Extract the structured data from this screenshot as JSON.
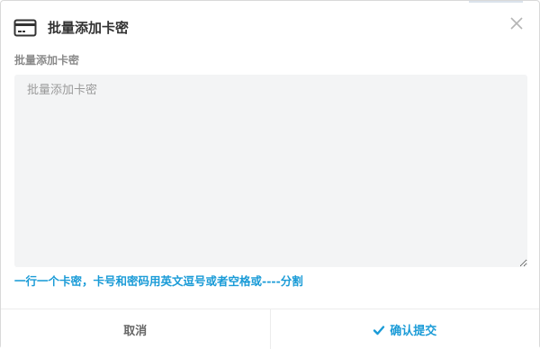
{
  "dialog": {
    "title": "批量添加卡密",
    "icon": "credit-card-icon",
    "close_icon": "close-icon"
  },
  "form": {
    "label": "批量添加卡密",
    "placeholder": "批量添加卡密",
    "value": "",
    "hint": "一行一个卡密，卡号和密码用英文逗号或者空格或----分割"
  },
  "footer": {
    "cancel_label": "取消",
    "confirm_label": "确认提交",
    "confirm_icon": "check-icon"
  },
  "colors": {
    "accent": "#1a9bd7",
    "textarea_bg": "#f3f4f5",
    "title_text": "#333333"
  }
}
